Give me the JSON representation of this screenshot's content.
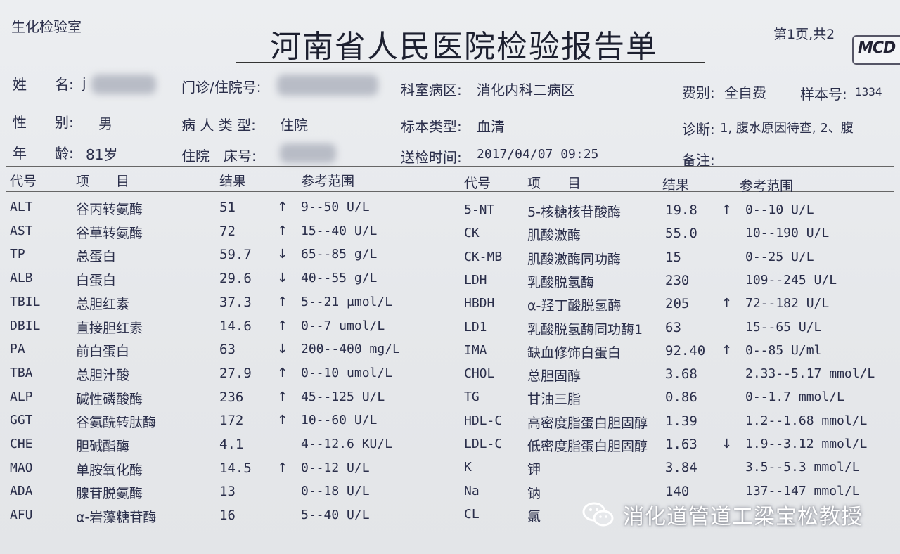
{
  "header": {
    "department": "生化检验室",
    "title": "河南省人民医院检验报告单",
    "page": "第1页,共2",
    "logo": "MCD"
  },
  "patient": {
    "name_label": "姓　　名:",
    "name_prefix": "j",
    "outpatient_label": "门诊/住院号:",
    "ward_label": "科室病区:",
    "ward_value": "消化内科二病区",
    "fee_label": "费别:",
    "fee_value": "全自费",
    "sample_label": "样本号:",
    "sample_value": "1334",
    "sex_label": "性　　别:",
    "sex_value": "男",
    "patient_type_label": "病 人 类 型:",
    "patient_type_value": "住院",
    "specimen_label": "标本类型:",
    "specimen_value": "血清",
    "diagnosis_label": "诊断:",
    "diagnosis_value": "1, 腹水原因待查, 2、腹",
    "age_label": "年　　龄:",
    "age_value": "81岁",
    "bed_label": "住院　床号:",
    "time_label": "送检时间:",
    "time_value": "2017/04/07 09:25",
    "remark_label": "备注:"
  },
  "columns": {
    "code": "代号",
    "item": "项　　目",
    "result": "结果",
    "range": "参考范围"
  },
  "left_rows": [
    {
      "code": "ALT",
      "name": "谷丙转氨酶",
      "result": "51",
      "flag": "↑",
      "range": "9--50 U/L"
    },
    {
      "code": "AST",
      "name": "谷草转氨酶",
      "result": "72",
      "flag": "↑",
      "range": "15--40 U/L"
    },
    {
      "code": "TP",
      "name": "总蛋白",
      "result": "59.7",
      "flag": "↓",
      "range": "65--85 g/L"
    },
    {
      "code": "ALB",
      "name": "白蛋白",
      "result": "29.6",
      "flag": "↓",
      "range": "40--55 g/L"
    },
    {
      "code": "TBIL",
      "name": "总胆红素",
      "result": "37.3",
      "flag": "↑",
      "range": "5--21 μmol/L"
    },
    {
      "code": "DBIL",
      "name": "直接胆红素",
      "result": "14.6",
      "flag": "↑",
      "range": "0--7 umol/L"
    },
    {
      "code": "PA",
      "name": "前白蛋白",
      "result": "63",
      "flag": "↓",
      "range": "200--400 mg/L"
    },
    {
      "code": "TBA",
      "name": "总胆汁酸",
      "result": "27.9",
      "flag": "↑",
      "range": "0--10 umol/L"
    },
    {
      "code": "ALP",
      "name": "碱性磷酸酶",
      "result": "236",
      "flag": "↑",
      "range": "45--125 U/L"
    },
    {
      "code": "GGT",
      "name": "谷氨酰转肽酶",
      "result": "172",
      "flag": "↑",
      "range": "10--60 U/L"
    },
    {
      "code": "CHE",
      "name": "胆碱酯酶",
      "result": "4.1",
      "flag": "",
      "range": "4--12.6 KU/L"
    },
    {
      "code": "MAO",
      "name": "单胺氧化酶",
      "result": "14.5",
      "flag": "↑",
      "range": "0--12 U/L"
    },
    {
      "code": "ADA",
      "name": "腺苷脱氨酶",
      "result": "13",
      "flag": "",
      "range": "0--18 U/L"
    },
    {
      "code": "AFU",
      "name": "α-岩藻糖苷酶",
      "result": "16",
      "flag": "",
      "range": "5--40 U/L"
    }
  ],
  "right_rows": [
    {
      "code": "5-NT",
      "name": "5-核糖核苷酸酶",
      "result": "19.8",
      "flag": "↑",
      "range": "0--10 U/L"
    },
    {
      "code": "CK",
      "name": "肌酸激酶",
      "result": "55.0",
      "flag": "",
      "range": "10--190 U/L"
    },
    {
      "code": "CK-MB",
      "name": "肌酸激酶同功酶",
      "result": "15",
      "flag": "",
      "range": "0--25 U/L"
    },
    {
      "code": "LDH",
      "name": "乳酸脱氢酶",
      "result": "230",
      "flag": "",
      "range": "109--245 U/L"
    },
    {
      "code": "HBDH",
      "name": "α-羟丁酸脱氢酶",
      "result": "205",
      "flag": "↑",
      "range": "72--182 U/L"
    },
    {
      "code": "LD1",
      "name": "乳酸脱氢酶同功酶1",
      "result": "63",
      "flag": "",
      "range": "15--65 U/L"
    },
    {
      "code": "IMA",
      "name": "缺血修饰白蛋白",
      "result": "92.40",
      "flag": "↑",
      "range": "0--85 U/ml"
    },
    {
      "code": "CHOL",
      "name": "总胆固醇",
      "result": "3.68",
      "flag": "",
      "range": "2.33--5.17 mmol/L"
    },
    {
      "code": "TG",
      "name": "甘油三脂",
      "result": "0.86",
      "flag": "",
      "range": "0--1.7 mmol/L"
    },
    {
      "code": "HDL-C",
      "name": "高密度脂蛋白胆固醇",
      "result": "1.39",
      "flag": "",
      "range": "1.2--1.68 mmol/L"
    },
    {
      "code": "LDL-C",
      "name": "低密度脂蛋白胆固醇",
      "result": "1.63",
      "flag": "↓",
      "range": "1.9--3.12 mmol/L"
    },
    {
      "code": "K",
      "name": "钾",
      "result": "3.84",
      "flag": "",
      "range": "3.5--5.3 mmol/L"
    },
    {
      "code": "Na",
      "name": "钠",
      "result": "140",
      "flag": "",
      "range": "137--147 mmol/L"
    },
    {
      "code": "CL",
      "name": "氯",
      "result": "",
      "flag": "",
      "range": ""
    }
  ],
  "watermark": {
    "text": "消化道管道工梁宝松教授",
    "icon": "wechat-icon"
  }
}
